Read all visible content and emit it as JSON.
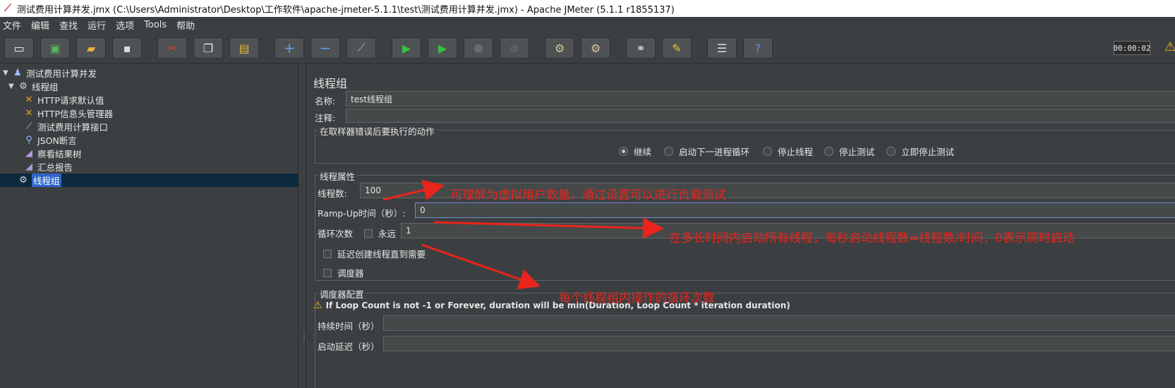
{
  "window": {
    "title": "测试费用计算并发.jmx (C:\\Users\\Administrator\\Desktop\\工作软件\\apache-jmeter-5.1.1\\test\\测试费用计算并发.jmx) - Apache JMeter (5.1.1 r1855137)"
  },
  "menu": [
    "文件",
    "编辑",
    "查找",
    "运行",
    "选项",
    "Tools",
    "帮助"
  ],
  "toolbar": {
    "icons": [
      "new-icon",
      "templates-icon",
      "open-icon",
      "save-icon",
      "cut-icon",
      "copy-icon",
      "paste-icon",
      "expand-icon",
      "collapse-icon",
      "toggle-icon",
      "start-icon",
      "start-no-pause-icon",
      "stop-icon",
      "shutdown-icon",
      "clear-icon",
      "clear-all-icon",
      "search-icon",
      "reset-search-icon",
      "function-helper-icon",
      "help-icon"
    ],
    "timer": "00:00:02"
  },
  "tree": {
    "items": [
      {
        "label": "测试费用计算并发",
        "icon": "test-plan-icon",
        "toggle": "▼"
      },
      {
        "label": "线程组",
        "icon": "gear-icon",
        "toggle": "▼"
      },
      {
        "label": "HTTP请求默认值",
        "icon": "wrench-icon",
        "toggle": ""
      },
      {
        "label": "HTTP信息头管理器",
        "icon": "wrench-icon",
        "toggle": ""
      },
      {
        "label": "测试费用计算接口",
        "icon": "sampler-icon",
        "toggle": ""
      },
      {
        "label": "JSON断言",
        "icon": "assertion-icon",
        "toggle": ""
      },
      {
        "label": "察看结果树",
        "icon": "listener-icon",
        "toggle": ""
      },
      {
        "label": "汇总报告",
        "icon": "listener-icon",
        "toggle": ""
      },
      {
        "label": "线程组",
        "icon": "gear-icon",
        "toggle": ""
      }
    ]
  },
  "panel": {
    "title": "线程组",
    "name_label": "名称:",
    "name_value": "test线程组",
    "comment_label": "注释:",
    "comment_value": "",
    "error_action": {
      "title": "在取样器错误后要执行的动作",
      "options": [
        "继续",
        "启动下一进程循环",
        "停止线程",
        "停止测试",
        "立即停止测试"
      ],
      "selected": "继续"
    },
    "thread_props": {
      "title": "线程属性",
      "threads_label": "线程数:",
      "threads_value": "100",
      "rampup_label": "Ramp-Up时间（秒）:",
      "rampup_value": "0",
      "loop_label": "循环次数",
      "forever_label": "永远",
      "loop_value": "1",
      "delay_label": "延迟创建线程直到需要",
      "scheduler_label": "调度器"
    },
    "scheduler": {
      "title": "调度器配置",
      "warning": "If Loop Count is not -1 or Forever, duration will be min(Duration, Loop Count * iteration duration)",
      "duration_label": "持续时间（秒）",
      "duration_value": "",
      "startup_delay_label": "启动延迟（秒）",
      "startup_delay_value": ""
    }
  },
  "annotations": {
    "threads": "可理解为虚拟用户数量，通过设置可以进行负载测试",
    "rampup": "在多长时间内启动所有线程，每秒启动线程数=线程数/时间，0表示同时启动",
    "loop": "每个线程组内操作的循环次数",
    "color": "#e8241b"
  }
}
